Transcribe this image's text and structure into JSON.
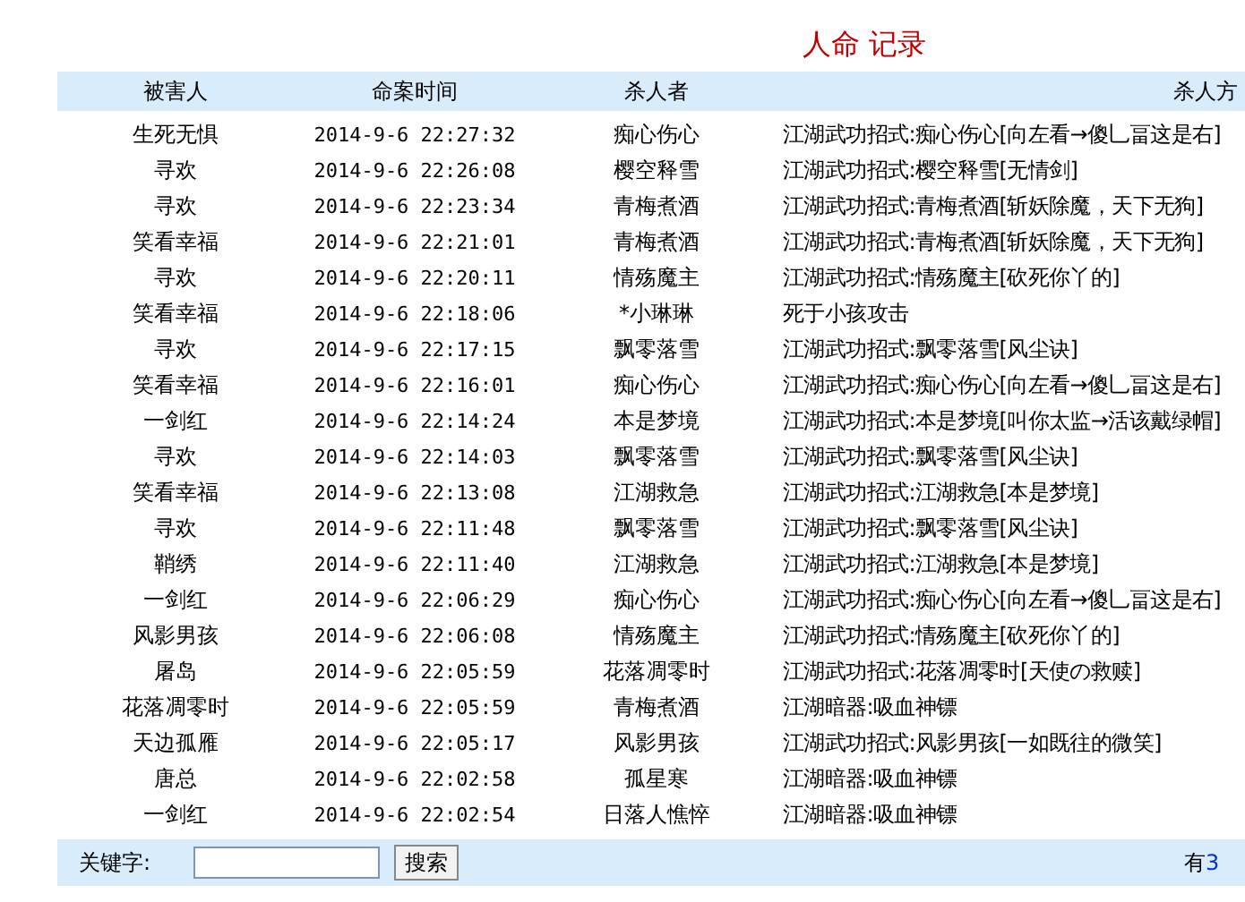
{
  "title": "人命 记录",
  "table": {
    "columns": [
      "被害人",
      "命案时间",
      "杀人者",
      "杀人方"
    ],
    "rows": [
      [
        "生死无惧",
        "2014-9-6 22:27:32",
        "痴心伤心",
        "江湖武功招式:痴心伤心[向左看→傻乚畐这是右]"
      ],
      [
        "寻欢",
        "2014-9-6 22:26:08",
        "樱空释雪",
        "江湖武功招式:樱空释雪[无情剑]"
      ],
      [
        "寻欢",
        "2014-9-6 22:23:34",
        "青梅煮酒",
        "江湖武功招式:青梅煮酒[斩妖除魔，天下无狗]"
      ],
      [
        "笑看幸福",
        "2014-9-6 22:21:01",
        "青梅煮酒",
        "江湖武功招式:青梅煮酒[斩妖除魔，天下无狗]"
      ],
      [
        "寻欢",
        "2014-9-6 22:20:11",
        "情殇魔主",
        "江湖武功招式:情殇魔主[砍死你丫的]"
      ],
      [
        "笑看幸福",
        "2014-9-6 22:18:06",
        "*小琳琳",
        "死于小孩攻击"
      ],
      [
        "寻欢",
        "2014-9-6 22:17:15",
        "飘零落雪",
        "江湖武功招式:飘零落雪[风尘诀]"
      ],
      [
        "笑看幸福",
        "2014-9-6 22:16:01",
        "痴心伤心",
        "江湖武功招式:痴心伤心[向左看→傻乚畐这是右]"
      ],
      [
        "一剑红",
        "2014-9-6 22:14:24",
        "本是梦境",
        "江湖武功招式:本是梦境[叫你太监→活该戴绿帽]"
      ],
      [
        "寻欢",
        "2014-9-6 22:14:03",
        "飘零落雪",
        "江湖武功招式:飘零落雪[风尘诀]"
      ],
      [
        "笑看幸福",
        "2014-9-6 22:13:08",
        "江湖救急",
        "江湖武功招式:江湖救急[本是梦境]"
      ],
      [
        "寻欢",
        "2014-9-6 22:11:48",
        "飘零落雪",
        "江湖武功招式:飘零落雪[风尘诀]"
      ],
      [
        "鞘绣",
        "2014-9-6 22:11:40",
        "江湖救急",
        "江湖武功招式:江湖救急[本是梦境]"
      ],
      [
        "一剑红",
        "2014-9-6 22:06:29",
        "痴心伤心",
        "江湖武功招式:痴心伤心[向左看→傻乚畐这是右]"
      ],
      [
        "风影男孩",
        "2014-9-6 22:06:08",
        "情殇魔主",
        "江湖武功招式:情殇魔主[砍死你丫的]"
      ],
      [
        "屠岛",
        "2014-9-6 22:05:59",
        "花落凋零时",
        "江湖武功招式:花落凋零时[天使の救赎]"
      ],
      [
        "花落凋零时",
        "2014-9-6 22:05:59",
        "青梅煮酒",
        "江湖暗器:吸血神镖"
      ],
      [
        "天边孤雁",
        "2014-9-6 22:05:17",
        "风影男孩",
        "江湖武功招式:风影男孩[一如既往的微笑]"
      ],
      [
        "唐总",
        "2014-9-6 22:02:58",
        "孤星寒",
        "江湖暗器:吸血神镖"
      ],
      [
        "一剑红",
        "2014-9-6 22:02:54",
        "日落人憔悴",
        "江湖暗器:吸血神镖"
      ]
    ]
  },
  "footer": {
    "keyword_label": "关键字:",
    "search_button": "搜索",
    "count_prefix": "有",
    "count_link": "3"
  }
}
